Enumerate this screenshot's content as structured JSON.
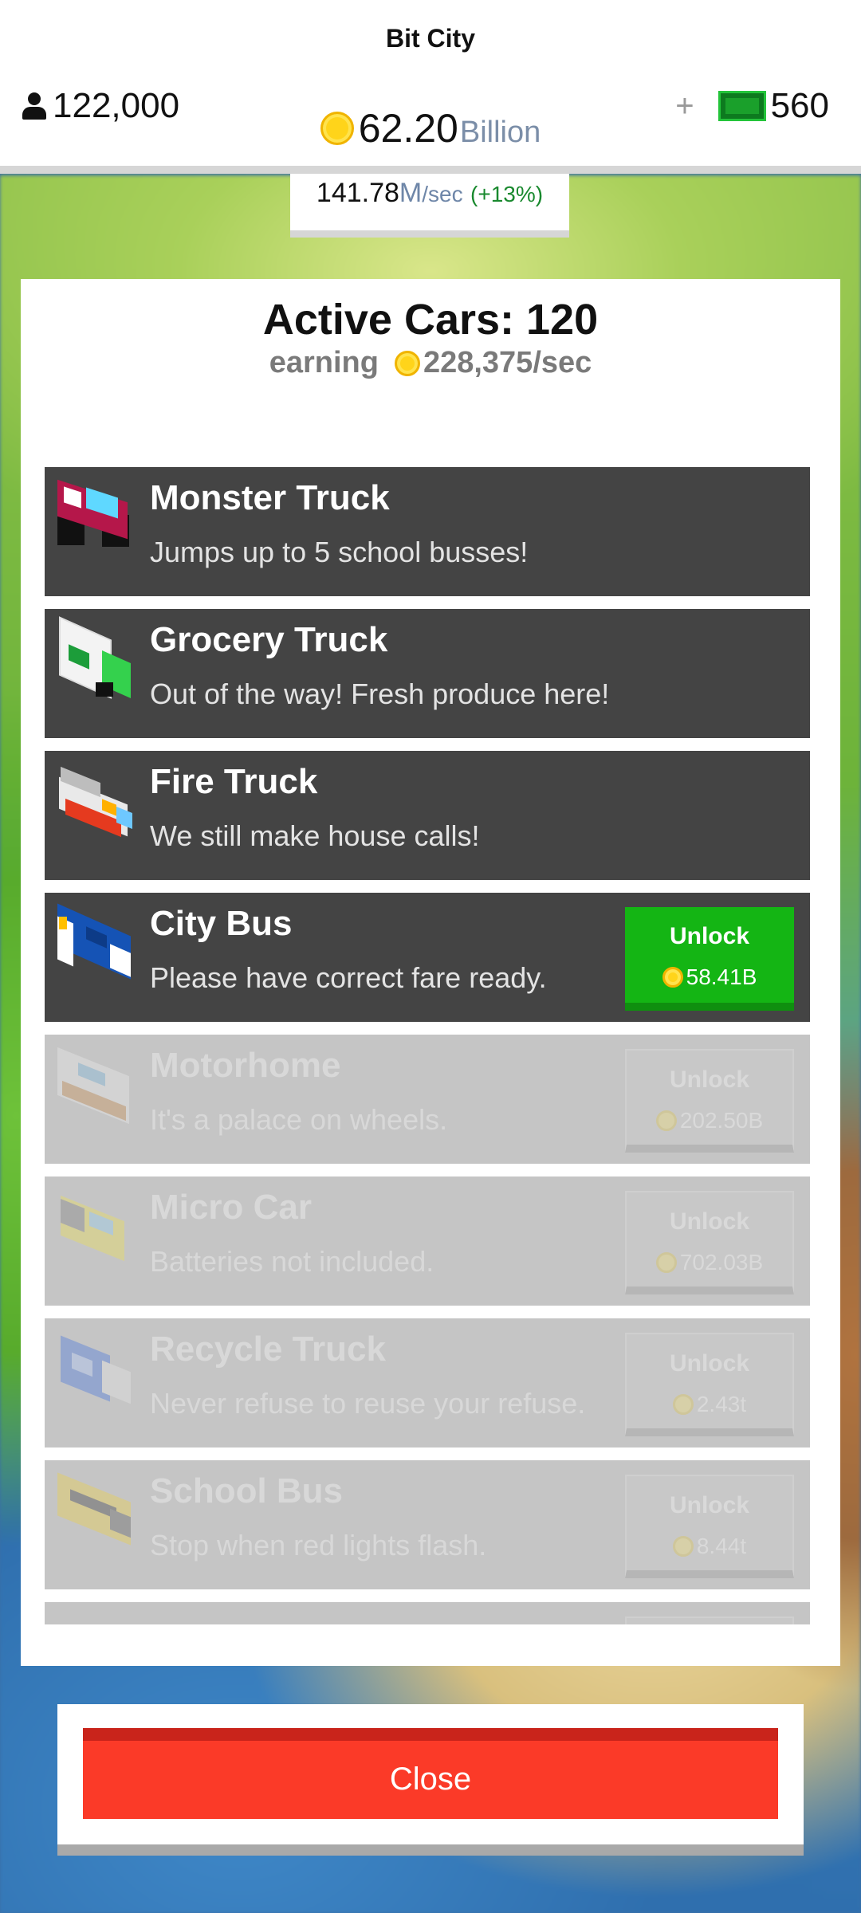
{
  "header": {
    "city_name": "Bit City",
    "population": "122,000",
    "money_value": "62.20",
    "money_unit": "Billion",
    "bux_plus": "+",
    "bux_value": "560",
    "rate_value": "141.78",
    "rate_unit": "M",
    "rate_suffix": "/sec",
    "rate_bonus": "(+13%)"
  },
  "panel": {
    "title": "Active Cars: 120",
    "earning_label": "earning",
    "earning_value": "228,375/sec"
  },
  "cars": [
    {
      "name": "Monster Truck",
      "desc": "Jumps up to 5 school busses!",
      "unlock_label": "",
      "price": "",
      "state": "owned",
      "icon": "monster-truck-icon"
    },
    {
      "name": "Grocery Truck",
      "desc": "Out of the way! Fresh produce here!",
      "unlock_label": "",
      "price": "",
      "state": "owned",
      "icon": "grocery-truck-icon"
    },
    {
      "name": "Fire Truck",
      "desc": "We still make house calls!",
      "unlock_label": "",
      "price": "",
      "state": "owned",
      "icon": "fire-truck-icon"
    },
    {
      "name": "City Bus",
      "desc": "Please have correct fare ready.",
      "unlock_label": "Unlock",
      "price": "58.41B",
      "state": "available",
      "icon": "city-bus-icon"
    },
    {
      "name": "Motorhome",
      "desc": "It's a palace on wheels.",
      "unlock_label": "Unlock",
      "price": "202.50B",
      "state": "locked",
      "icon": "motorhome-icon"
    },
    {
      "name": "Micro Car",
      "desc": "Batteries not included.",
      "unlock_label": "Unlock",
      "price": "702.03B",
      "state": "locked",
      "icon": "micro-car-icon"
    },
    {
      "name": "Recycle Truck",
      "desc": "Never refuse to reuse your refuse.",
      "unlock_label": "Unlock",
      "price": "2.43t",
      "state": "locked",
      "icon": "recycle-truck-icon"
    },
    {
      "name": "School Bus",
      "desc": "Stop when red lights flash.",
      "unlock_label": "Unlock",
      "price": "8.44t",
      "state": "locked",
      "icon": "school-bus-icon"
    }
  ],
  "close_label": "Close",
  "colors": {
    "unlock_green": "#14b514",
    "close_red": "#fb3a28",
    "row_dark": "#444444",
    "row_locked": "#c5c5c5",
    "coin_yellow": "#ffd41a",
    "bux_green": "#1aa02b"
  }
}
